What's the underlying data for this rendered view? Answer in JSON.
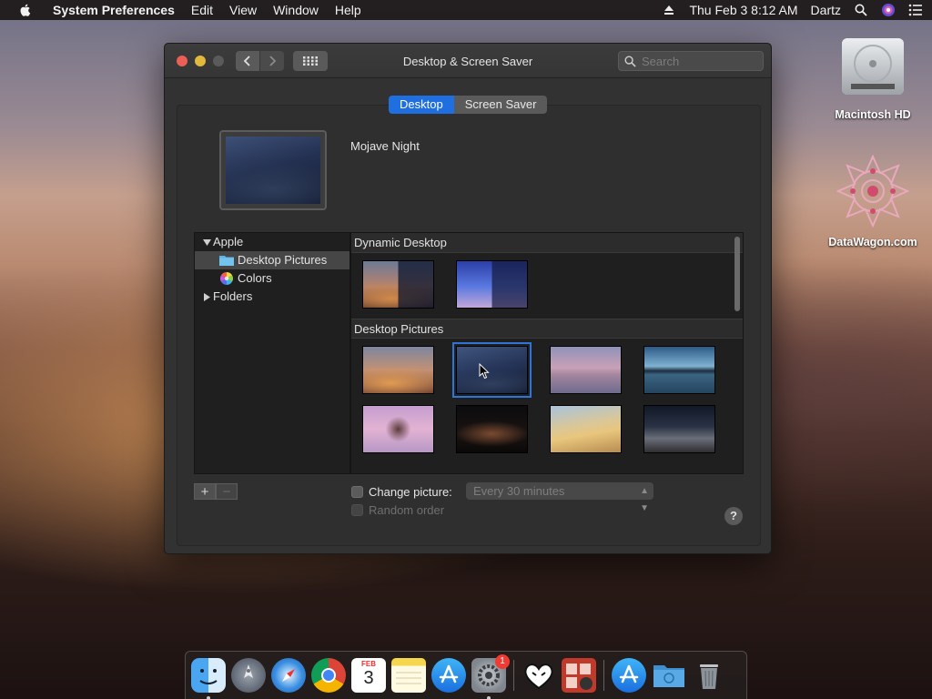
{
  "menubar": {
    "app_name": "System Preferences",
    "menus": [
      "Edit",
      "View",
      "Window",
      "Help"
    ],
    "clock": "Thu Feb 3  8:12 AM",
    "user": "Dartz"
  },
  "desktop_icons": [
    {
      "label": "Macintosh HD",
      "icon": "hard-drive-icon"
    },
    {
      "label": "DataWagon.com",
      "icon": "pink-mandala-icon"
    }
  ],
  "window": {
    "title": "Desktop & Screen Saver",
    "search_placeholder": "Search",
    "tabs": [
      {
        "label": "Desktop",
        "selected": true
      },
      {
        "label": "Screen Saver",
        "selected": false
      }
    ],
    "current_picture": "Mojave Night",
    "source_list": [
      {
        "label": "Apple",
        "expanded": true,
        "level": 0,
        "icon": "disclosure-down-icon"
      },
      {
        "label": "Desktop Pictures",
        "level": 1,
        "selected": true,
        "icon": "folder-icon"
      },
      {
        "label": "Colors",
        "level": 1,
        "icon": "color-wheel-icon"
      },
      {
        "label": "Folders",
        "expanded": false,
        "level": 0,
        "icon": "disclosure-right-icon"
      }
    ],
    "sections": [
      {
        "title": "Dynamic Desktop",
        "count": 2
      },
      {
        "title": "Desktop Pictures",
        "count": 8
      }
    ],
    "add_label": "+",
    "remove_label": "−",
    "change_picture_label": "Change picture:",
    "change_picture_checked": false,
    "interval_value": "Every 30 minutes",
    "random_order_label": "Random order",
    "help_label": "?"
  },
  "dock": {
    "apps": [
      "finder-icon",
      "launchpad-icon",
      "safari-icon",
      "chrome-icon",
      "calendar-icon",
      "notes-icon",
      "app-store-icon",
      "system-preferences-icon",
      "heart-app-icon",
      "photo-booth-icon",
      "app-store-folder-icon",
      "downloads-folder-icon",
      "trash-icon"
    ],
    "calendar_month": "FEB",
    "calendar_day": "3",
    "prefs_badge": "1"
  }
}
